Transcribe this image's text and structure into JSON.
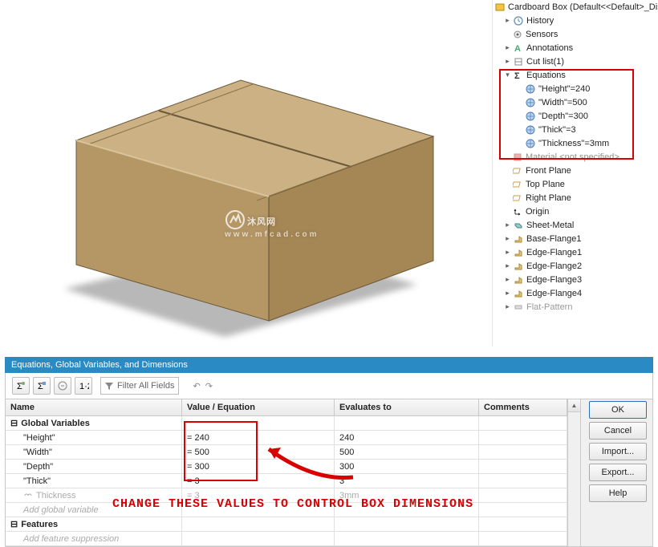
{
  "tree": {
    "root": "Cardboard Box (Default<<Default>_Displa",
    "history": "History",
    "sensors": "Sensors",
    "annotations": "Annotations",
    "cutlist": "Cut list(1)",
    "equations": "Equations",
    "eq": [
      "\"Height\"=240",
      "\"Width\"=500",
      "\"Depth\"=300",
      "\"Thick\"=3",
      "\"Thickness\"=3mm"
    ],
    "material": "Material <not specified>",
    "front": "Front Plane",
    "top": "Top Plane",
    "right": "Right Plane",
    "origin": "Origin",
    "sheet": "Sheet-Metal",
    "base": "Base-Flange1",
    "ef1": "Edge-Flange1",
    "ef2": "Edge-Flange2",
    "ef3": "Edge-Flange3",
    "ef4": "Edge-Flange4",
    "flat": "Flat-Pattern"
  },
  "watermark": {
    "main": "沐风网",
    "sub": "www.mfcad.com"
  },
  "panel": {
    "title": "Equations, Global Variables, and Dimensions",
    "filter": "Filter All Fields",
    "cols": {
      "name": "Name",
      "value": "Value / Equation",
      "eval": "Evaluates to",
      "comments": "Comments"
    },
    "globals": "Global Variables",
    "r1": {
      "n": "\"Height\"",
      "v": "= 240",
      "e": "240"
    },
    "r2": {
      "n": "\"Width\"",
      "v": "= 500",
      "e": "500"
    },
    "r3": {
      "n": "\"Depth\"",
      "v": "= 300",
      "e": "300"
    },
    "r4": {
      "n": "\"Thick\"",
      "v": "= 3",
      "e": "3"
    },
    "r5": {
      "n": "Thickness",
      "v": "= 3",
      "e": "3mm"
    },
    "add": "Add global variable",
    "features": "Features",
    "addf": "Add feature suppression"
  },
  "buttons": {
    "ok": "OK",
    "cancel": "Cancel",
    "import": "Import...",
    "export": "Export...",
    "help": "Help"
  },
  "callout": "CHANGE THESE VALUES TO CONTROL BOX DIMENSIONS"
}
